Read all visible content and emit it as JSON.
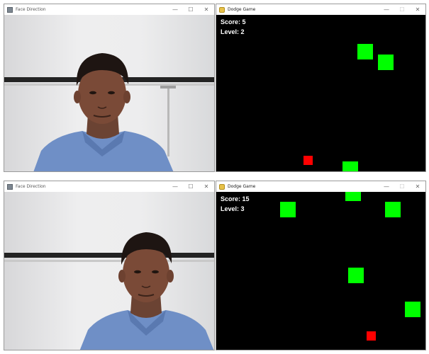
{
  "colors": {
    "enemy": "#00ff00",
    "player": "#ff0000",
    "game_bg": "#000000",
    "text": "#ffffff"
  },
  "top": {
    "camera": {
      "title": "Face Direction",
      "icon": "camera-app-icon"
    },
    "game": {
      "title": "Dodge Game",
      "icon": "game-app-icon",
      "score_label": "Score: 5",
      "level_label": "Level: 2"
    }
  },
  "bottom": {
    "camera": {
      "title": "Face Direction",
      "icon": "camera-app-icon"
    },
    "game": {
      "title": "Dodge Game",
      "icon": "game-app-icon",
      "score_label": "Score: 15",
      "level_label": "Level: 3"
    }
  },
  "window_controls": {
    "minimize": "—",
    "maximize": "☐",
    "close": "✕"
  }
}
